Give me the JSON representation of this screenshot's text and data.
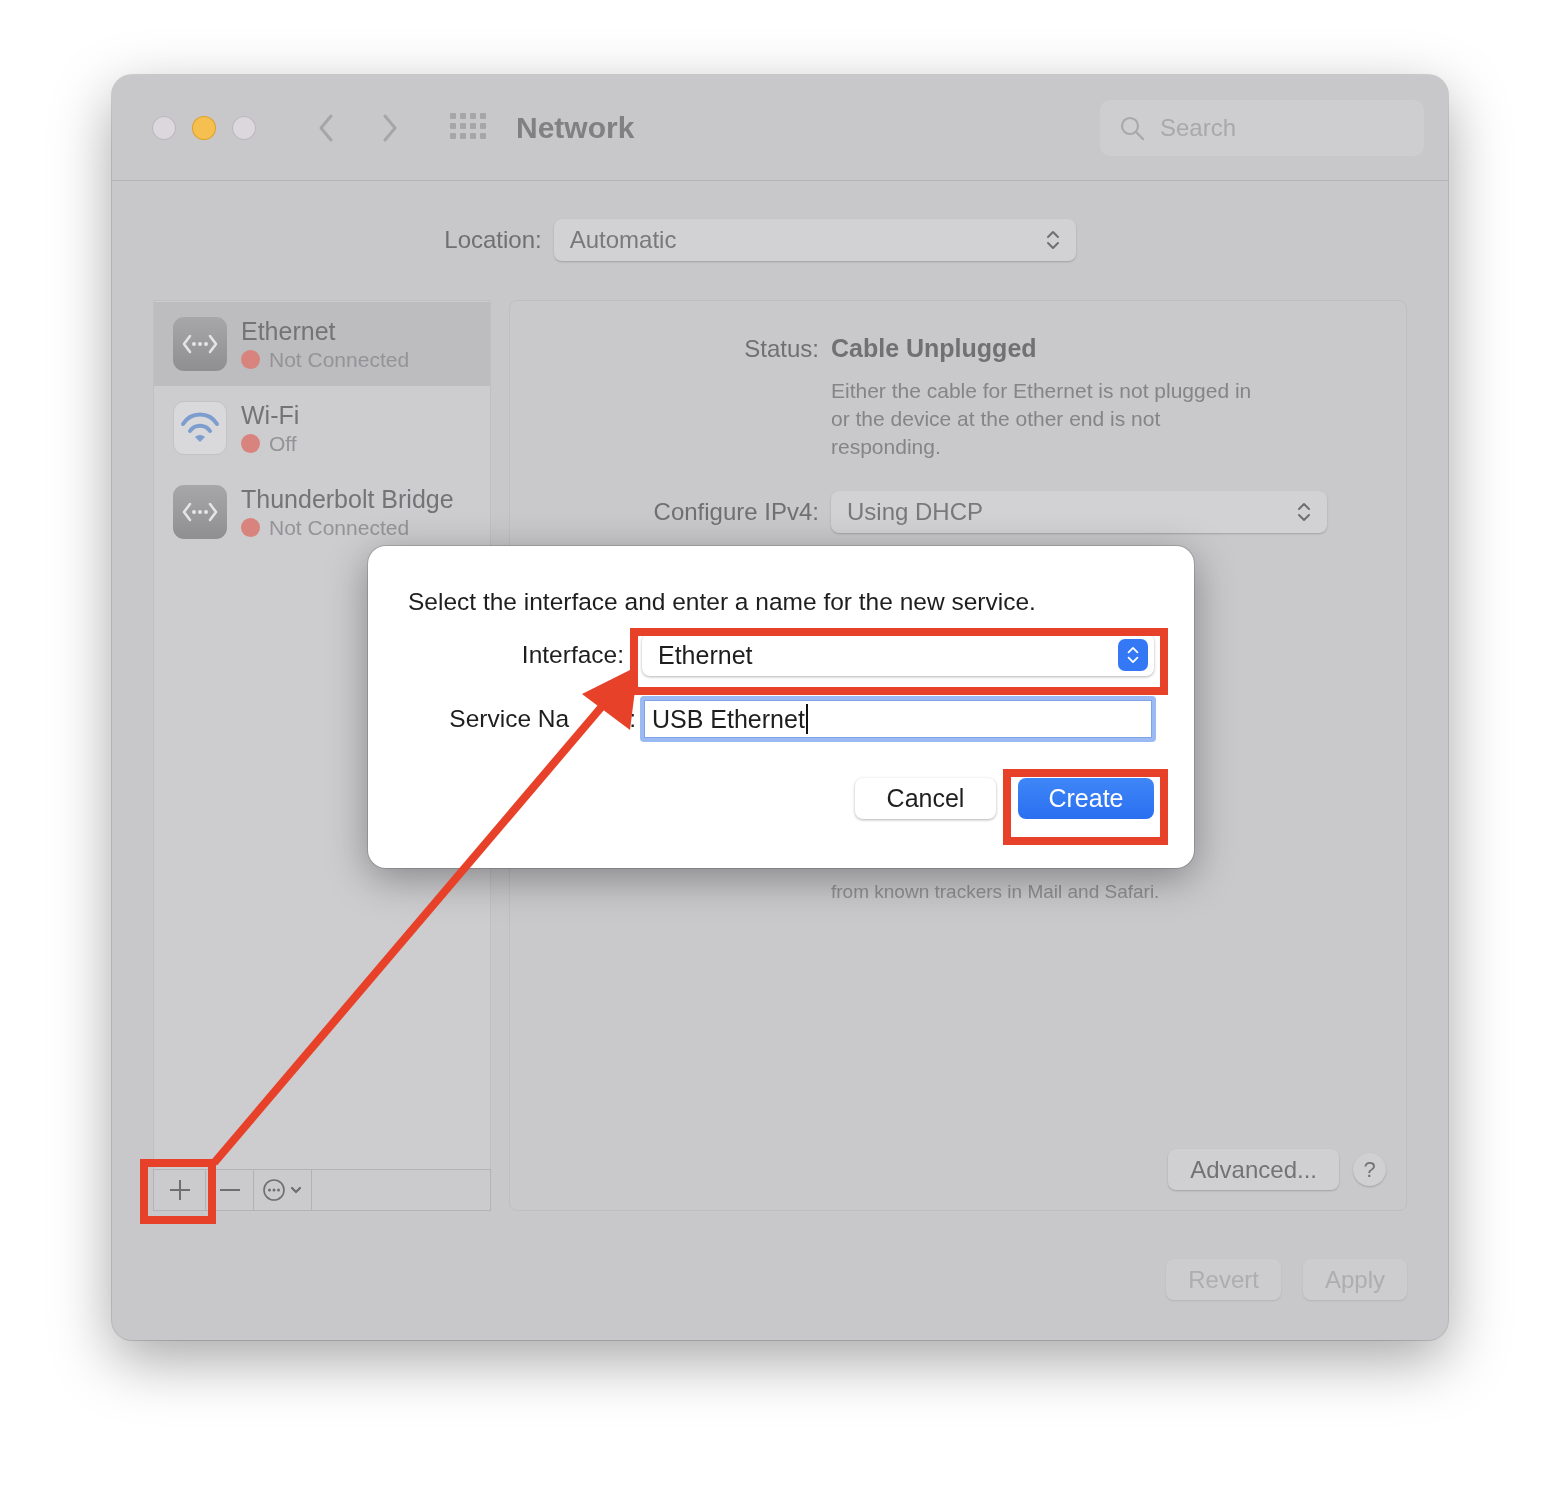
{
  "window": {
    "title": "Network",
    "search": {
      "placeholder": "Search"
    }
  },
  "location": {
    "label": "Location:",
    "value": "Automatic"
  },
  "services": [
    {
      "name": "Ethernet",
      "status": "Not Connected",
      "color": "#d8837d",
      "kind": "wired",
      "selected": true
    },
    {
      "name": "Wi-Fi",
      "status": "Off",
      "color": "#d8837d",
      "kind": "wifi",
      "selected": false
    },
    {
      "name": "Thunderbolt Bridge",
      "status": "Not Connected",
      "color": "#d8837d",
      "kind": "wired",
      "selected": false
    }
  ],
  "detail": {
    "status_label": "Status:",
    "status_value": "Cable Unplugged",
    "status_description": "Either the cable for Ethernet is not plugged in or the device at the other end is not responding.",
    "configure_label": "Configure IPv4:",
    "configure_value": "Using DHCP",
    "privacy_note": "from known trackers in Mail and Safari.",
    "advanced": "Advanced...",
    "help": "?"
  },
  "footer_buttons": [
    {
      "label": "Revert",
      "disabled": true
    },
    {
      "label": "Apply",
      "disabled": true
    }
  ],
  "dialog": {
    "message": "Select the interface and enter a name for the new service.",
    "interface_label": "Interface:",
    "interface_value": "Ethernet",
    "service_name_label": "Service Na",
    "service_name_colon": ":",
    "service_name_value": "USB Ethernet",
    "buttons": [
      {
        "label": "Cancel",
        "default": false
      },
      {
        "label": "Create",
        "default": true
      }
    ]
  }
}
